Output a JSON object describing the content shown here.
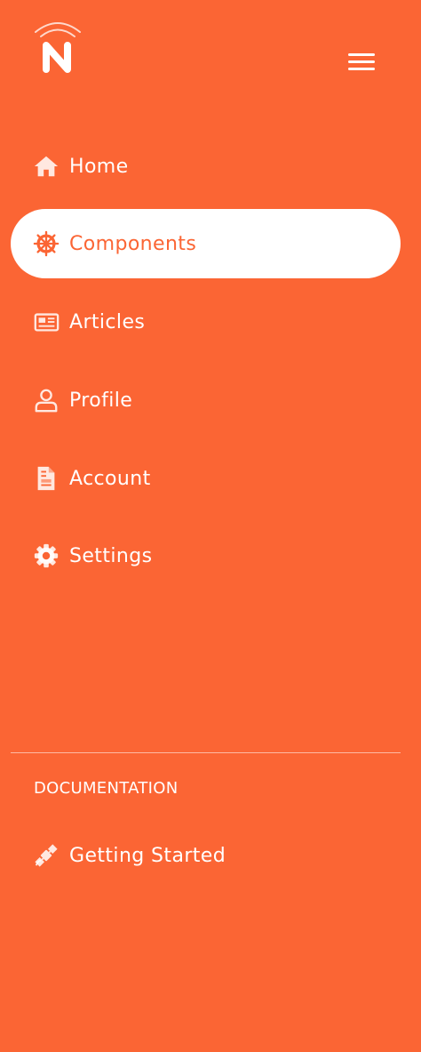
{
  "brand": {
    "logo_icon": "brand-n-logo-icon"
  },
  "header": {
    "menu_icon": "hamburger-menu-icon"
  },
  "colors": {
    "background": "#FB6534",
    "active_bg": "#FFFFFF",
    "text": "#FFFFFF",
    "active_text": "#FB6534"
  },
  "nav": {
    "items": [
      {
        "label": "Home",
        "icon": "home-icon",
        "active": false
      },
      {
        "label": "Components",
        "icon": "ship-wheel-icon",
        "active": true
      },
      {
        "label": "Articles",
        "icon": "newspaper-icon",
        "active": false
      },
      {
        "label": "Profile",
        "icon": "user-icon",
        "active": false
      },
      {
        "label": "Account",
        "icon": "document-icon",
        "active": false
      },
      {
        "label": "Settings",
        "icon": "gear-icon",
        "active": false
      }
    ]
  },
  "documentation": {
    "heading": "DOCUMENTATION",
    "items": [
      {
        "label": "Getting Started",
        "icon": "satellite-icon",
        "active": false
      }
    ]
  }
}
